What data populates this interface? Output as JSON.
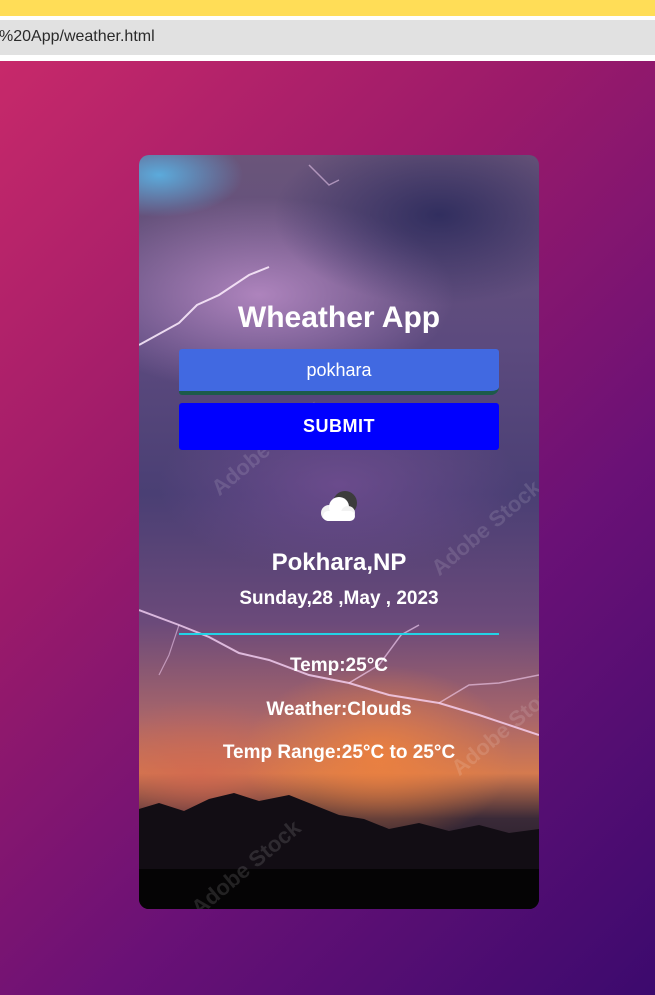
{
  "browser": {
    "address_text": "%20App/weather.html"
  },
  "app": {
    "title": "Wheather App",
    "search": {
      "value": "pokhara",
      "placeholder": ""
    },
    "submit_label": "SUBMIT",
    "weather_icon": "cloud-icon",
    "location": "Pokhara,NP",
    "date": "Sunday,28 ,May , 2023",
    "temp": "Temp:25°C",
    "weather": "Weather:Clouds",
    "temp_range": "Temp Range:25°C to 25°C",
    "watermark": "Adobe Stock"
  },
  "colors": {
    "input_bg": "#4169e1",
    "button_bg": "#0000ff",
    "divider": "#22d3e6",
    "page_gradient_start": "#c7296a",
    "page_gradient_end": "#3c0a6e"
  }
}
